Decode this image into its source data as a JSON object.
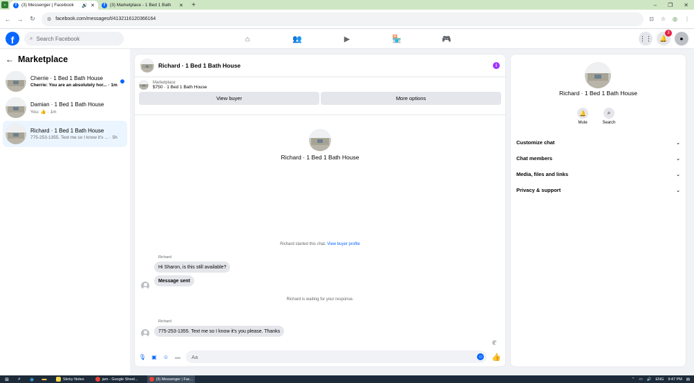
{
  "browser": {
    "tabs": [
      {
        "title": "(3) Messenger | Facebook",
        "active": true
      },
      {
        "title": "(3) Marketplace - 1 Bed 1 Bath",
        "active": false
      }
    ],
    "url": "facebook.com/messages/t/413211612036616 4",
    "url_clean": "facebook.com/messages/t/4132116120366164"
  },
  "fb": {
    "search_placeholder": "Search Facebook",
    "notifications_count": "3"
  },
  "left": {
    "title": "Marketplace",
    "conversations": [
      {
        "name": "Cherrie · 1 Bed 1 Bath House",
        "preview": "Cherrie: You are an absolutely hor... · 1m",
        "unread": true
      },
      {
        "name": "Damian · 1 Bed 1 Bath House",
        "preview": "You: 👍 · 1m",
        "unread": false
      },
      {
        "name": "Richard · 1 Bed 1 Bath House",
        "preview": "775-253-1355. Text me so I know it's ... · 5h",
        "unread": false
      }
    ]
  },
  "chat": {
    "title": "Richard · 1 Bed 1 Bath House",
    "marketplace_label": "Marketplace",
    "listing_info": "$750 · 1 Bed 1 Bath House",
    "view_buyer": "View buyer",
    "more_options": "More options",
    "profile_name": "Richard · 1 Bed 1 Bath House",
    "started_note": "Richard started this chat.",
    "started_link": "View buyer profile",
    "sender1": "Richard",
    "msg1": "Hi Sharon, is this still available?",
    "msg2": "Message sent",
    "waiting_note": "Richard is waiting for your response.",
    "sender2": "Richard",
    "msg3": "775-253-1355. Text me so I know it's you please. Thanks",
    "composer_placeholder": "Aa"
  },
  "right": {
    "name": "Richard · 1 Bed 1 Bath House",
    "mute": "Mute",
    "search": "Search",
    "menu": [
      "Customize chat",
      "Chat members",
      "Media, files and links",
      "Privacy & support"
    ]
  },
  "taskbar": {
    "apps": [
      "Sticky Notes",
      "jam - Google Sheet...",
      "(3) Messenger | Fac..."
    ],
    "lang": "ENG",
    "time": "9:47 PM"
  },
  "colors": {
    "accent": "#0866ff",
    "badge": "#e41e3f",
    "selected_bg": "#ebf5ff"
  }
}
